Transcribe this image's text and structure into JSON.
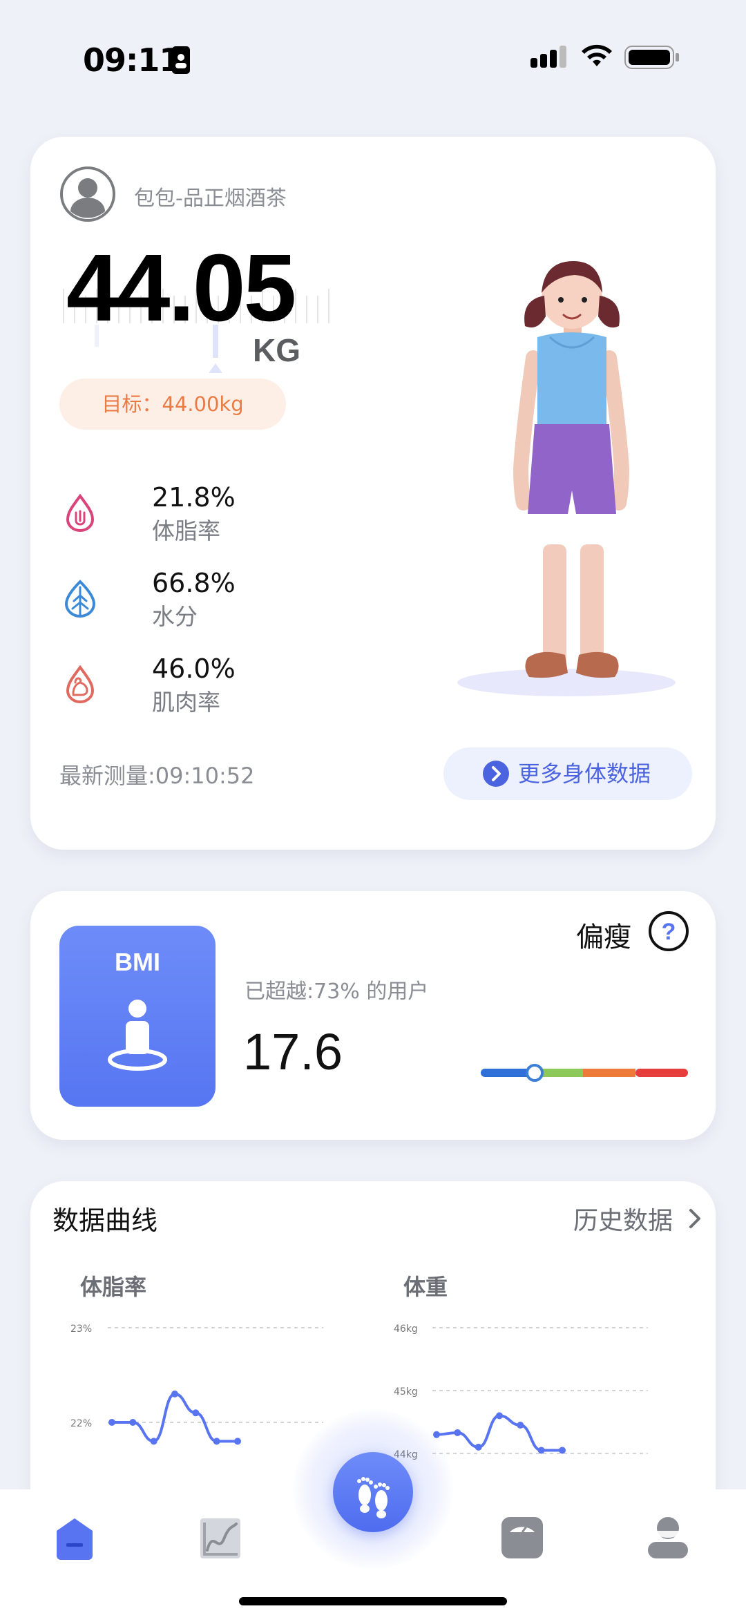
{
  "status_bar": {
    "time": "09:11"
  },
  "weight_card": {
    "username": "包包-品正烟酒茶",
    "weight": "44.05",
    "unit": "KG",
    "goal": "目标：44.00kg",
    "metrics": [
      {
        "value": "21.8%",
        "label": "体脂率",
        "icon": "body-fat-icon",
        "color": "#d9457a"
      },
      {
        "value": "66.8%",
        "label": "水分",
        "icon": "water-leaf-icon",
        "color": "#3b8ad8"
      },
      {
        "value": "46.0%",
        "label": "肌肉率",
        "icon": "muscle-icon",
        "color": "#e06a5f"
      }
    ],
    "last_measure": "最新测量:09:10:52",
    "more_button": "更多身体数据"
  },
  "bmi_card": {
    "tile_label": "BMI",
    "rank_text": "已超越:73% 的用户",
    "value": "17.6",
    "status": "偏瘦",
    "scale_position": 0.25,
    "scale_colors": [
      "#2f6fd8",
      "#8cc95a",
      "#ee7a3a",
      "#e63d3d"
    ]
  },
  "curve_card": {
    "title": "数据曲线",
    "history_link": "历史数据",
    "charts": [
      {
        "title": "体脂率",
        "y_labels": [
          "23%",
          "22%"
        ],
        "values": [
          22.0,
          22.0,
          21.8,
          22.3,
          22.1,
          21.8,
          21.8
        ]
      },
      {
        "title": "体重",
        "y_labels": [
          "46kg",
          "45kg",
          "44kg"
        ],
        "values": [
          44.3,
          44.33,
          44.1,
          44.6,
          44.45,
          44.05,
          44.05
        ]
      }
    ]
  },
  "tabbar": {
    "tabs": [
      "home-icon",
      "trend-chart-icon",
      "footprint-icon",
      "scale-icon",
      "profile-icon"
    ],
    "active_color": "#5874f0"
  }
}
